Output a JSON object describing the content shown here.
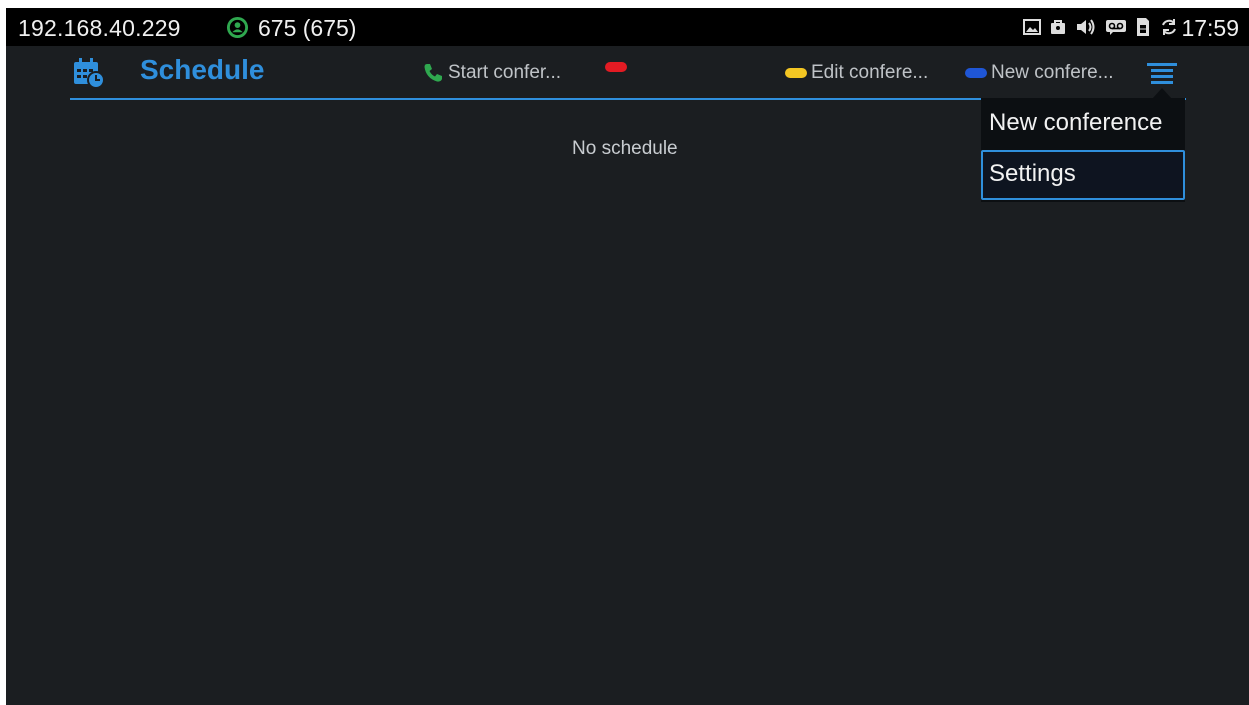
{
  "status_bar": {
    "ip": "192.168.40.229",
    "account": "675 (675)",
    "time": "17:59",
    "icons": [
      "image-icon",
      "lock-bag-icon",
      "volume-icon",
      "voicemail-icon",
      "sim-card-icon",
      "sync-icon"
    ]
  },
  "header": {
    "title": "Schedule",
    "hints": {
      "start": "Start confer...",
      "red": "",
      "edit": "Edit confere...",
      "new": "New confere..."
    }
  },
  "content": {
    "empty_message": "No schedule"
  },
  "popup_menu": {
    "items": [
      {
        "label": "New conference"
      },
      {
        "label": "Settings",
        "focused": true
      }
    ]
  },
  "colors": {
    "accent": "#2f8fdc",
    "red_key": "#e31b23",
    "yellow_key": "#f3c623",
    "blue_key": "#1f56d6",
    "green_call": "#2fa84f",
    "background": "#1b1e21"
  }
}
